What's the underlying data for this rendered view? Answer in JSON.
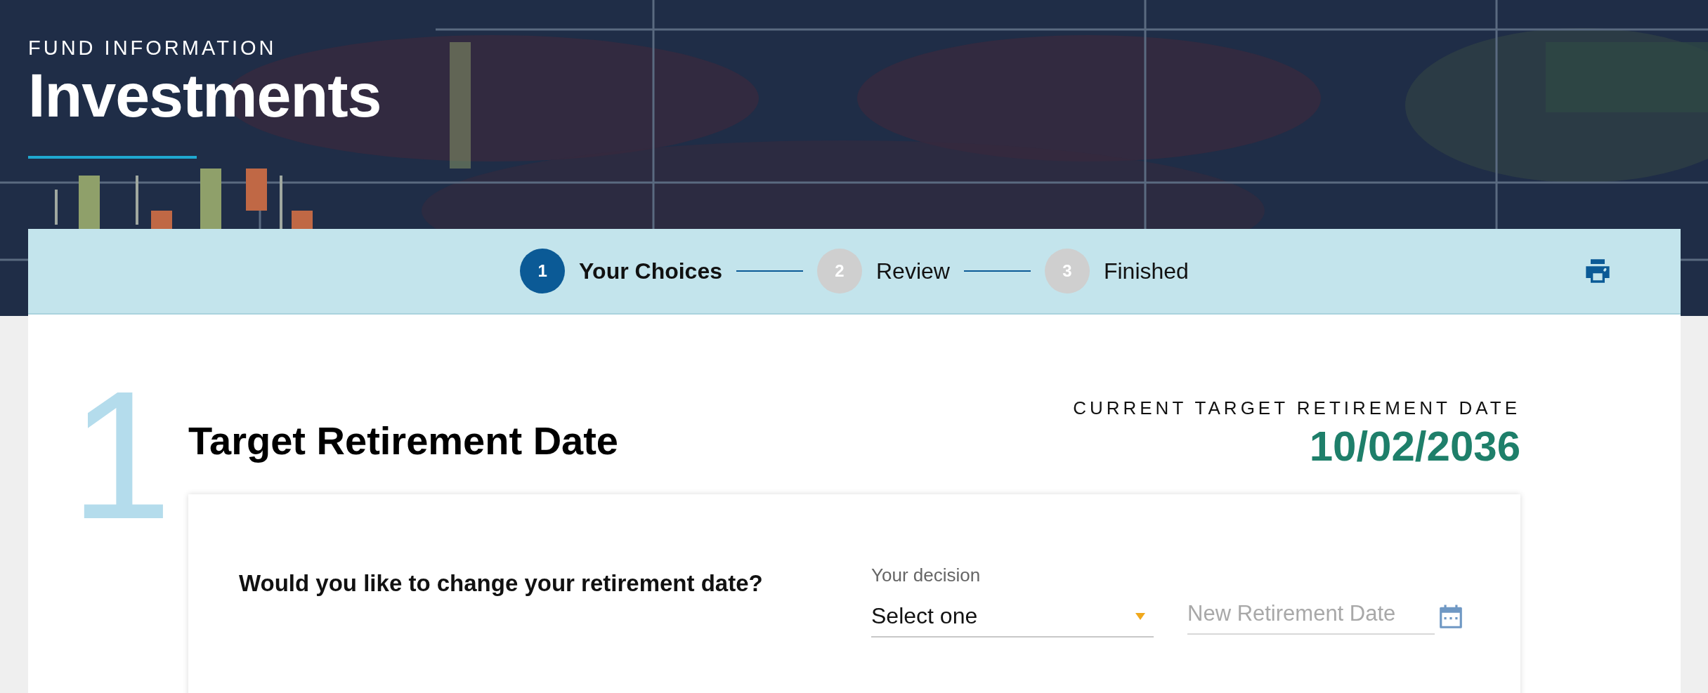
{
  "header": {
    "eyebrow": "FUND INFORMATION",
    "title": "Investments"
  },
  "stepper": {
    "steps": [
      {
        "number": "1",
        "label": "Your Choices",
        "selected": true
      },
      {
        "number": "2",
        "label": "Review",
        "selected": false
      },
      {
        "number": "3",
        "label": "Finished",
        "selected": false
      }
    ]
  },
  "section": {
    "number": "1",
    "title": "Target Retirement Date",
    "current_label": "CURRENT TARGET RETIREMENT DATE",
    "current_value": "10/02/2036"
  },
  "question": {
    "text": "Would you like to change your retirement date?",
    "decision": {
      "label": "Your decision",
      "value": "Select one"
    },
    "date_field": {
      "placeholder": "New Retirement Date"
    }
  }
}
